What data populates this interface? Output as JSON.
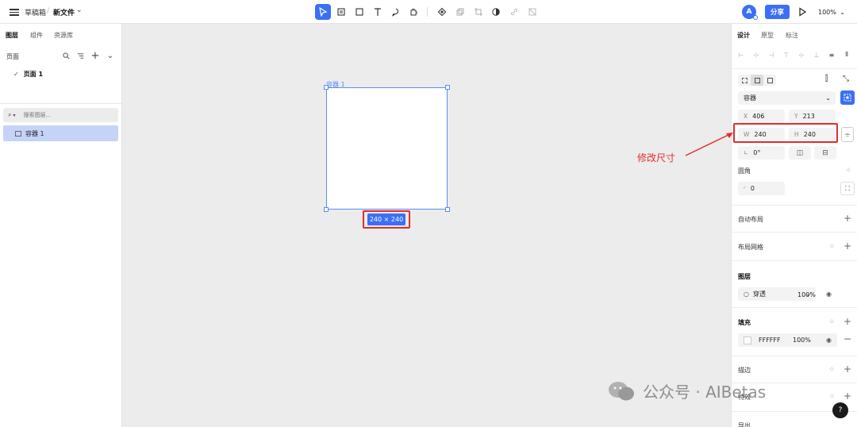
{
  "topbar": {
    "breadcrumb_root": "草稿箱",
    "breadcrumb_sep": "/",
    "file_name": "新文件",
    "avatar_letter": "A",
    "share_label": "分享",
    "zoom_value": "100%"
  },
  "left_panel": {
    "tabs": [
      "图层",
      "组件",
      "资源库"
    ],
    "active_tab": 0,
    "pages_label": "页面",
    "page_item": "页面 1",
    "search_placeholder": "搜索图层...",
    "layer_item": "容器 1"
  },
  "canvas": {
    "frame_label": "容器 1",
    "size_badge": "240 × 240",
    "background": "#ececec"
  },
  "right_panel": {
    "tabs": [
      "设计",
      "原型",
      "标注"
    ],
    "active_tab": 0,
    "element_type": "容器",
    "x_label": "X",
    "x_value": "406",
    "y_label": "Y",
    "y_value": "213",
    "w_label": "W",
    "w_value": "240",
    "h_label": "H",
    "h_value": "240",
    "rotation": "0°",
    "radius_title": "圆角",
    "radius_value": "0",
    "auto_layout": "自动布局",
    "layout_grid": "布局网格",
    "layer_title": "图层",
    "blend_mode": "穿透",
    "layer_opacity": "100%",
    "fill_title": "填充",
    "fill_hex": "FFFFFF",
    "fill_opacity": "100%",
    "stroke_title": "描边",
    "effects_title": "特效",
    "export_title": "导出"
  },
  "annotation": {
    "text": "修改尺寸",
    "color": "#e22d2d"
  },
  "watermark": {
    "text": "公众号 · AIBetas"
  },
  "help_label": "?",
  "colors": {
    "accent": "#3b6ff5",
    "selection": "#5b8af5",
    "layer_highlight": "#c5d3f7"
  }
}
